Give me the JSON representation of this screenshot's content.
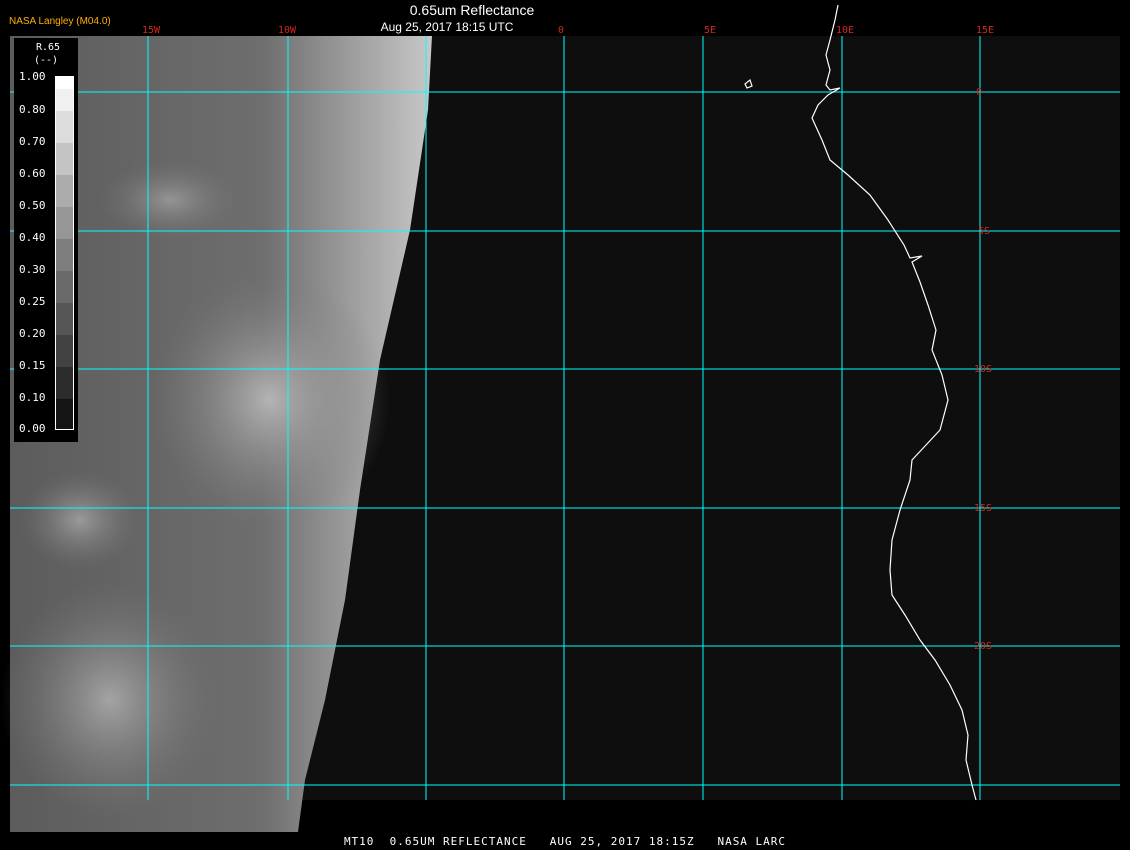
{
  "header": {
    "agency": "NASA Langley (M04.0)",
    "title": "0.65um Reflectance",
    "timestamp": "Aug 25, 2017 18:15 UTC"
  },
  "grid": {
    "color": "#00ffff",
    "label_color": "#d0281e",
    "longitudes": [
      "15W",
      "10W",
      "0",
      "5E",
      "10E",
      "15E"
    ],
    "latitudes": [
      "0",
      "5S",
      "10S",
      "15S",
      "20S"
    ]
  },
  "colorbar": {
    "title": "R.65",
    "unit": "(--)",
    "ticks": [
      "1.00",
      "0.80",
      "0.70",
      "0.60",
      "0.50",
      "0.40",
      "0.30",
      "0.25",
      "0.20",
      "0.15",
      "0.10",
      "0.00"
    ]
  },
  "footer": {
    "text": "MT10  0.65UM REFLECTANCE   AUG 25, 2017 18:15Z   NASA LARC"
  },
  "colors": {
    "background": "#000000",
    "dark_ocean": "#0e0e0e",
    "coastline": "#ffffff"
  }
}
